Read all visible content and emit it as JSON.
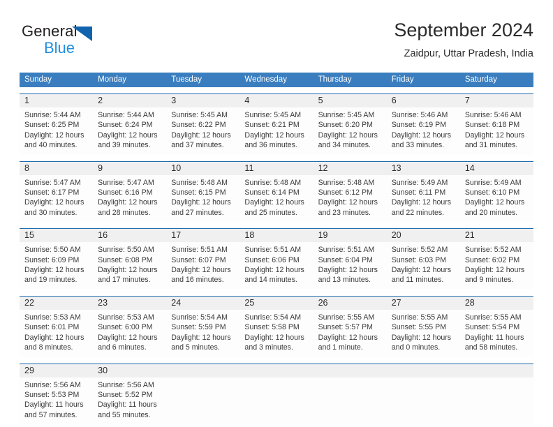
{
  "brand": {
    "name_part1": "General",
    "name_part2": "Blue",
    "triangle_color": "#1263ae",
    "blue_text_color": "#1f8fe0"
  },
  "header": {
    "title": "September 2024",
    "subtitle": "Zaidpur, Uttar Pradesh, India"
  },
  "theme": {
    "header_blue": "#3a7ebf",
    "row_rule_blue": "#1f6cb0",
    "number_band_gray": "#f0f0f0"
  },
  "weekdays": [
    "Sunday",
    "Monday",
    "Tuesday",
    "Wednesday",
    "Thursday",
    "Friday",
    "Saturday"
  ],
  "weeks": [
    [
      {
        "day": "1",
        "sunrise": "Sunrise: 5:44 AM",
        "sunset": "Sunset: 6:25 PM",
        "daylight1": "Daylight: 12 hours",
        "daylight2": "and 40 minutes."
      },
      {
        "day": "2",
        "sunrise": "Sunrise: 5:44 AM",
        "sunset": "Sunset: 6:24 PM",
        "daylight1": "Daylight: 12 hours",
        "daylight2": "and 39 minutes."
      },
      {
        "day": "3",
        "sunrise": "Sunrise: 5:45 AM",
        "sunset": "Sunset: 6:22 PM",
        "daylight1": "Daylight: 12 hours",
        "daylight2": "and 37 minutes."
      },
      {
        "day": "4",
        "sunrise": "Sunrise: 5:45 AM",
        "sunset": "Sunset: 6:21 PM",
        "daylight1": "Daylight: 12 hours",
        "daylight2": "and 36 minutes."
      },
      {
        "day": "5",
        "sunrise": "Sunrise: 5:45 AM",
        "sunset": "Sunset: 6:20 PM",
        "daylight1": "Daylight: 12 hours",
        "daylight2": "and 34 minutes."
      },
      {
        "day": "6",
        "sunrise": "Sunrise: 5:46 AM",
        "sunset": "Sunset: 6:19 PM",
        "daylight1": "Daylight: 12 hours",
        "daylight2": "and 33 minutes."
      },
      {
        "day": "7",
        "sunrise": "Sunrise: 5:46 AM",
        "sunset": "Sunset: 6:18 PM",
        "daylight1": "Daylight: 12 hours",
        "daylight2": "and 31 minutes."
      }
    ],
    [
      {
        "day": "8",
        "sunrise": "Sunrise: 5:47 AM",
        "sunset": "Sunset: 6:17 PM",
        "daylight1": "Daylight: 12 hours",
        "daylight2": "and 30 minutes."
      },
      {
        "day": "9",
        "sunrise": "Sunrise: 5:47 AM",
        "sunset": "Sunset: 6:16 PM",
        "daylight1": "Daylight: 12 hours",
        "daylight2": "and 28 minutes."
      },
      {
        "day": "10",
        "sunrise": "Sunrise: 5:48 AM",
        "sunset": "Sunset: 6:15 PM",
        "daylight1": "Daylight: 12 hours",
        "daylight2": "and 27 minutes."
      },
      {
        "day": "11",
        "sunrise": "Sunrise: 5:48 AM",
        "sunset": "Sunset: 6:14 PM",
        "daylight1": "Daylight: 12 hours",
        "daylight2": "and 25 minutes."
      },
      {
        "day": "12",
        "sunrise": "Sunrise: 5:48 AM",
        "sunset": "Sunset: 6:12 PM",
        "daylight1": "Daylight: 12 hours",
        "daylight2": "and 23 minutes."
      },
      {
        "day": "13",
        "sunrise": "Sunrise: 5:49 AM",
        "sunset": "Sunset: 6:11 PM",
        "daylight1": "Daylight: 12 hours",
        "daylight2": "and 22 minutes."
      },
      {
        "day": "14",
        "sunrise": "Sunrise: 5:49 AM",
        "sunset": "Sunset: 6:10 PM",
        "daylight1": "Daylight: 12 hours",
        "daylight2": "and 20 minutes."
      }
    ],
    [
      {
        "day": "15",
        "sunrise": "Sunrise: 5:50 AM",
        "sunset": "Sunset: 6:09 PM",
        "daylight1": "Daylight: 12 hours",
        "daylight2": "and 19 minutes."
      },
      {
        "day": "16",
        "sunrise": "Sunrise: 5:50 AM",
        "sunset": "Sunset: 6:08 PM",
        "daylight1": "Daylight: 12 hours",
        "daylight2": "and 17 minutes."
      },
      {
        "day": "17",
        "sunrise": "Sunrise: 5:51 AM",
        "sunset": "Sunset: 6:07 PM",
        "daylight1": "Daylight: 12 hours",
        "daylight2": "and 16 minutes."
      },
      {
        "day": "18",
        "sunrise": "Sunrise: 5:51 AM",
        "sunset": "Sunset: 6:06 PM",
        "daylight1": "Daylight: 12 hours",
        "daylight2": "and 14 minutes."
      },
      {
        "day": "19",
        "sunrise": "Sunrise: 5:51 AM",
        "sunset": "Sunset: 6:04 PM",
        "daylight1": "Daylight: 12 hours",
        "daylight2": "and 13 minutes."
      },
      {
        "day": "20",
        "sunrise": "Sunrise: 5:52 AM",
        "sunset": "Sunset: 6:03 PM",
        "daylight1": "Daylight: 12 hours",
        "daylight2": "and 11 minutes."
      },
      {
        "day": "21",
        "sunrise": "Sunrise: 5:52 AM",
        "sunset": "Sunset: 6:02 PM",
        "daylight1": "Daylight: 12 hours",
        "daylight2": "and 9 minutes."
      }
    ],
    [
      {
        "day": "22",
        "sunrise": "Sunrise: 5:53 AM",
        "sunset": "Sunset: 6:01 PM",
        "daylight1": "Daylight: 12 hours",
        "daylight2": "and 8 minutes."
      },
      {
        "day": "23",
        "sunrise": "Sunrise: 5:53 AM",
        "sunset": "Sunset: 6:00 PM",
        "daylight1": "Daylight: 12 hours",
        "daylight2": "and 6 minutes."
      },
      {
        "day": "24",
        "sunrise": "Sunrise: 5:54 AM",
        "sunset": "Sunset: 5:59 PM",
        "daylight1": "Daylight: 12 hours",
        "daylight2": "and 5 minutes."
      },
      {
        "day": "25",
        "sunrise": "Sunrise: 5:54 AM",
        "sunset": "Sunset: 5:58 PM",
        "daylight1": "Daylight: 12 hours",
        "daylight2": "and 3 minutes."
      },
      {
        "day": "26",
        "sunrise": "Sunrise: 5:55 AM",
        "sunset": "Sunset: 5:57 PM",
        "daylight1": "Daylight: 12 hours",
        "daylight2": "and 1 minute."
      },
      {
        "day": "27",
        "sunrise": "Sunrise: 5:55 AM",
        "sunset": "Sunset: 5:55 PM",
        "daylight1": "Daylight: 12 hours",
        "daylight2": "and 0 minutes."
      },
      {
        "day": "28",
        "sunrise": "Sunrise: 5:55 AM",
        "sunset": "Sunset: 5:54 PM",
        "daylight1": "Daylight: 11 hours",
        "daylight2": "and 58 minutes."
      }
    ],
    [
      {
        "day": "29",
        "sunrise": "Sunrise: 5:56 AM",
        "sunset": "Sunset: 5:53 PM",
        "daylight1": "Daylight: 11 hours",
        "daylight2": "and 57 minutes."
      },
      {
        "day": "30",
        "sunrise": "Sunrise: 5:56 AM",
        "sunset": "Sunset: 5:52 PM",
        "daylight1": "Daylight: 11 hours",
        "daylight2": "and 55 minutes."
      },
      {
        "day": "",
        "sunrise": "",
        "sunset": "",
        "daylight1": "",
        "daylight2": ""
      },
      {
        "day": "",
        "sunrise": "",
        "sunset": "",
        "daylight1": "",
        "daylight2": ""
      },
      {
        "day": "",
        "sunrise": "",
        "sunset": "",
        "daylight1": "",
        "daylight2": ""
      },
      {
        "day": "",
        "sunrise": "",
        "sunset": "",
        "daylight1": "",
        "daylight2": ""
      },
      {
        "day": "",
        "sunrise": "",
        "sunset": "",
        "daylight1": "",
        "daylight2": ""
      }
    ]
  ]
}
